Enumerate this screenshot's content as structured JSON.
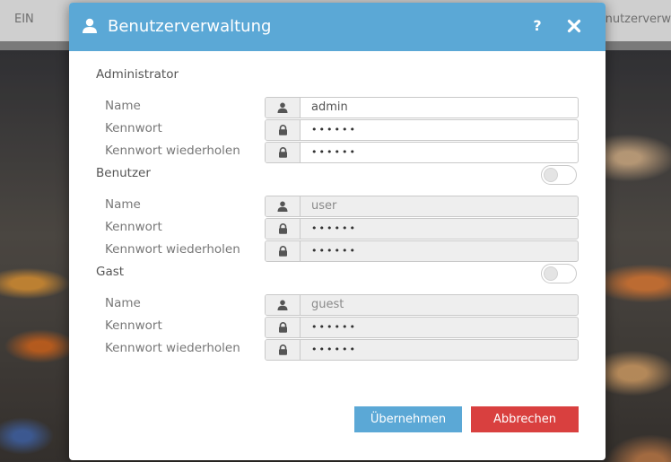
{
  "background": {
    "left_text": "EIN",
    "right_text": "Benutzerverw"
  },
  "dialog": {
    "title": "Benutzerverwaltung",
    "help_label": "?",
    "header_color": "#5ba8d6"
  },
  "sections": [
    {
      "title": "Administrator",
      "enabled": true,
      "has_toggle": false,
      "fields": [
        {
          "label": "Name",
          "icon": "user-icon",
          "value": "admin"
        },
        {
          "label": "Kennwort",
          "icon": "lock-icon",
          "value": "••••••"
        },
        {
          "label": "Kennwort wiederholen",
          "icon": "lock-icon",
          "value": "••••••"
        }
      ]
    },
    {
      "title": "Benutzer",
      "enabled": false,
      "has_toggle": true,
      "toggle_on": false,
      "fields": [
        {
          "label": "Name",
          "icon": "user-icon",
          "value": "user"
        },
        {
          "label": "Kennwort",
          "icon": "lock-icon",
          "value": "••••••"
        },
        {
          "label": "Kennwort wiederholen",
          "icon": "lock-icon",
          "value": "••••••"
        }
      ]
    },
    {
      "title": "Gast",
      "enabled": false,
      "has_toggle": true,
      "toggle_on": false,
      "fields": [
        {
          "label": "Name",
          "icon": "user-icon",
          "value": "guest"
        },
        {
          "label": "Kennwort",
          "icon": "lock-icon",
          "value": "••••••"
        },
        {
          "label": "Kennwort wiederholen",
          "icon": "lock-icon",
          "value": "••••••"
        }
      ]
    }
  ],
  "buttons": {
    "apply": "Übernehmen",
    "cancel": "Abbrechen",
    "apply_color": "#5ba8d6",
    "cancel_color": "#d9403f"
  }
}
